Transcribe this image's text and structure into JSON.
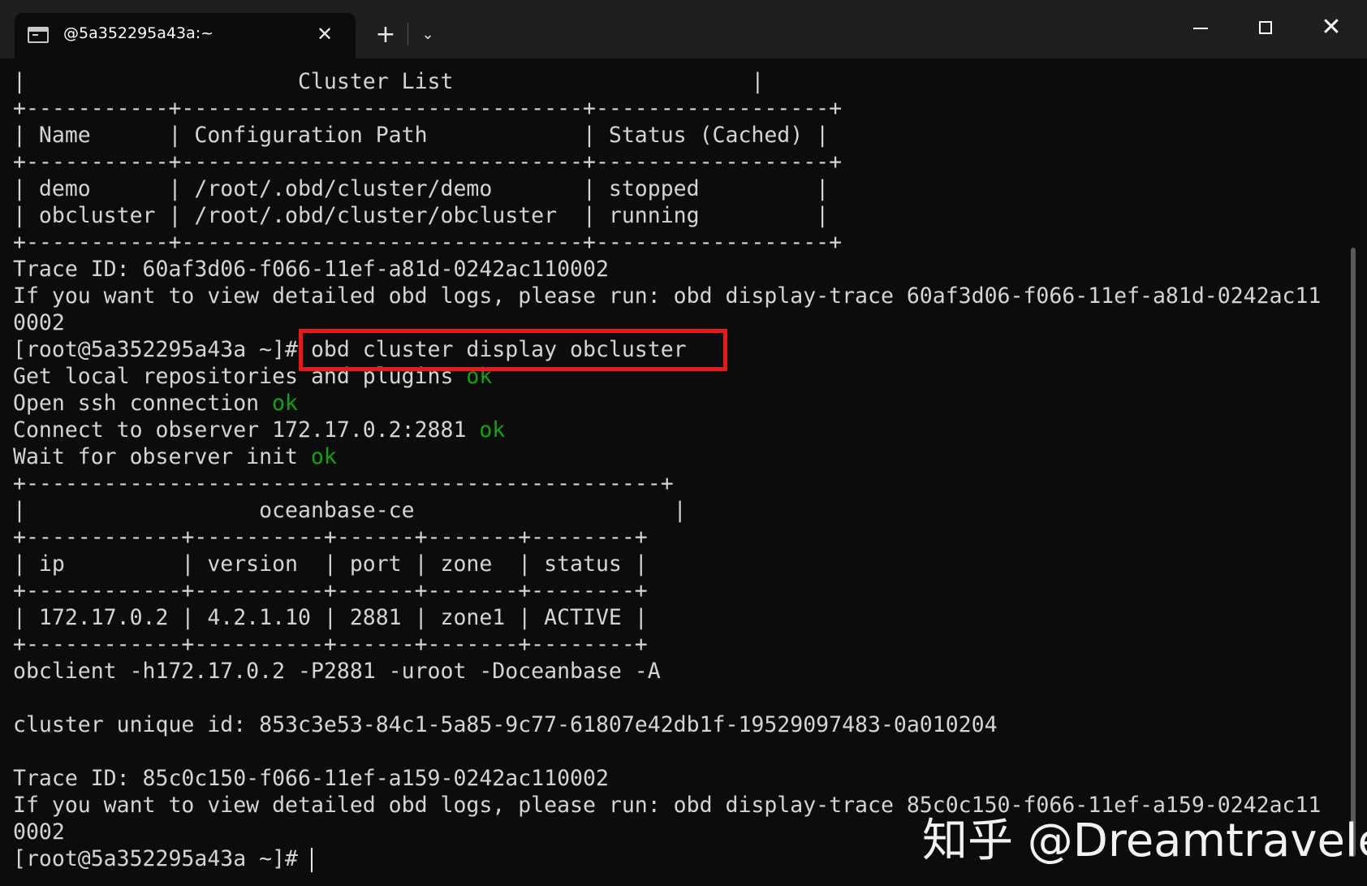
{
  "titlebar": {
    "tab_title": "@5a352295a43a:~",
    "tab_icon": "terminal-icon",
    "tab_close_glyph": "✕",
    "new_tab_glyph": "+",
    "dropdown_glyph": "⌄",
    "close_glyph": "✕"
  },
  "terminal": {
    "lines": [
      {
        "t": "|                     Cluster List                       |"
      },
      {
        "t": "+-----------+-------------------------------+------------------+"
      },
      {
        "t": "| Name      | Configuration Path            | Status (Cached) |"
      },
      {
        "t": "+-----------+-------------------------------+------------------+"
      },
      {
        "t": "| demo      | /root/.obd/cluster/demo       | stopped         |"
      },
      {
        "t": "| obcluster | /root/.obd/cluster/obcluster  | running         |"
      },
      {
        "t": "+-----------+-------------------------------+------------------+"
      },
      {
        "t": "Trace ID: 60af3d06-f066-11ef-a81d-0242ac110002"
      },
      {
        "t": "If you want to view detailed obd logs, please run: obd display-trace 60af3d06-f066-11ef-a81d-0242ac11"
      },
      {
        "t": "0002"
      },
      {
        "t": "[root@5a352295a43a ~]# obd cluster display obcluster"
      },
      {
        "t": "Get local repositories and plugins ",
        "ok": "ok"
      },
      {
        "t": "Open ssh connection ",
        "ok": "ok"
      },
      {
        "t": "Connect to observer 172.17.0.2:2881 ",
        "ok": "ok"
      },
      {
        "t": "Wait for observer init ",
        "ok": "ok"
      },
      {
        "t": "+-------------------------------------------------+"
      },
      {
        "t": "|                  oceanbase-ce                    |"
      },
      {
        "t": "+------------+----------+------+-------+--------+"
      },
      {
        "t": "| ip         | version  | port | zone  | status |"
      },
      {
        "t": "+------------+----------+------+-------+--------+"
      },
      {
        "t": "| 172.17.0.2 | 4.2.1.10 | 2881 | zone1 | ACTIVE |"
      },
      {
        "t": "+------------+----------+------+-------+--------+"
      },
      {
        "t": "obclient -h172.17.0.2 -P2881 -uroot -Doceanbase -A"
      },
      {
        "t": ""
      },
      {
        "t": "cluster unique id: 853c3e53-84c1-5a85-9c77-61807e42db1f-19529097483-0a010204"
      },
      {
        "t": ""
      },
      {
        "t": "Trace ID: 85c0c150-f066-11ef-a159-0242ac110002"
      },
      {
        "t": "If you want to view detailed obd logs, please run: obd display-trace 85c0c150-f066-11ef-a159-0242ac11"
      },
      {
        "t": "0002"
      },
      {
        "t": "[root@5a352295a43a ~]# ",
        "cursor": true
      }
    ]
  },
  "highlight": {
    "color": "#e8191b"
  },
  "colors": {
    "background": "#0c0c0c",
    "text": "#d4d4d4",
    "ok": "#13a10e",
    "titlebar": "#1f1f1f"
  },
  "watermark": "知乎 @Dreamtraveler"
}
